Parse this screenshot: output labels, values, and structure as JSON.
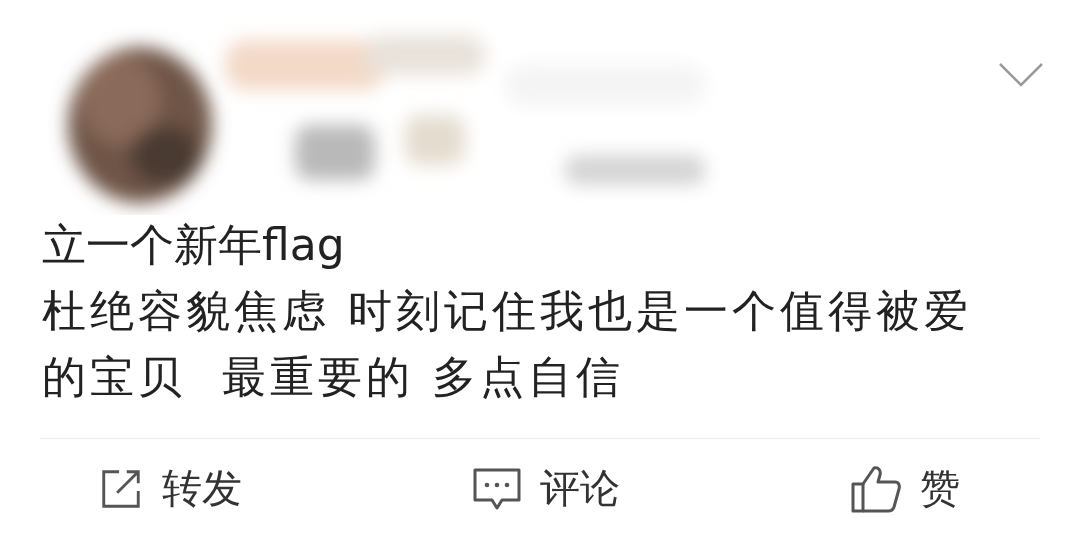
{
  "post": {
    "title": "立一个新年flag",
    "body": "杜绝容貌焦虑 时刻记住我也是一个值得被爱的宝贝  最重要的 多点自信"
  },
  "actions": [
    {
      "kind": "share",
      "label": "转发"
    },
    {
      "kind": "comment",
      "label": "评论"
    },
    {
      "kind": "like",
      "label": "赞"
    }
  ]
}
